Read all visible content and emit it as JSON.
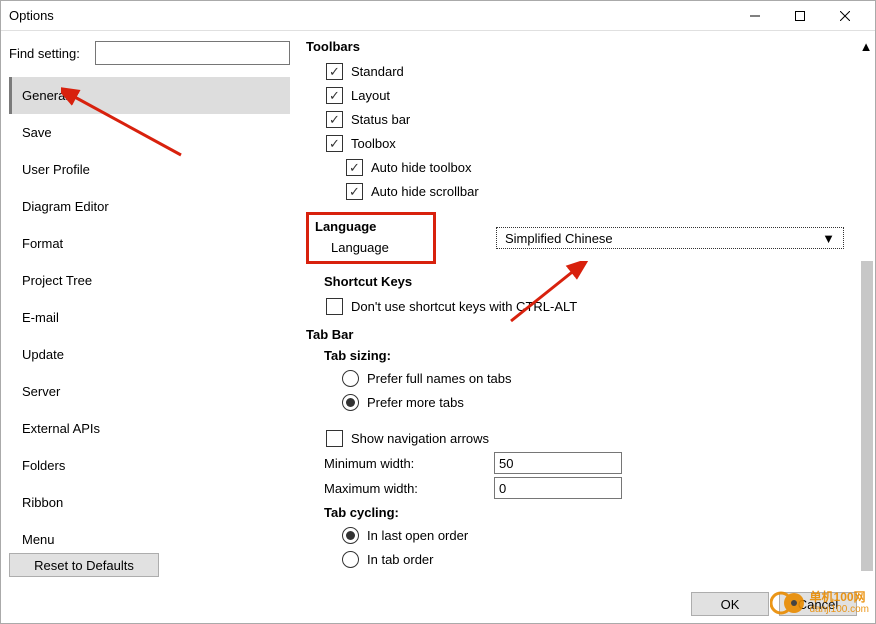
{
  "window": {
    "title": "Options"
  },
  "find": {
    "label": "Find setting:",
    "value": ""
  },
  "sidebar": {
    "items": [
      {
        "label": "General",
        "selected": true
      },
      {
        "label": "Save"
      },
      {
        "label": "User Profile"
      },
      {
        "label": "Diagram Editor"
      },
      {
        "label": "Format"
      },
      {
        "label": "Project Tree"
      },
      {
        "label": "E-mail"
      },
      {
        "label": "Update"
      },
      {
        "label": "Server"
      },
      {
        "label": "External APIs"
      },
      {
        "label": "Folders"
      },
      {
        "label": "Ribbon"
      },
      {
        "label": "Menu"
      }
    ],
    "toolbars_label": "Toolbars",
    "reset_label": "Reset to Defaults"
  },
  "toolbars": {
    "title": "Toolbars",
    "items": [
      {
        "label": "Standard",
        "checked": true
      },
      {
        "label": "Layout",
        "checked": true
      },
      {
        "label": "Status bar",
        "checked": true
      },
      {
        "label": "Toolbox",
        "checked": true
      }
    ],
    "sub": [
      {
        "label": "Auto hide toolbox",
        "checked": true
      },
      {
        "label": "Auto hide scrollbar",
        "checked": true
      }
    ]
  },
  "language": {
    "title": "Language",
    "label": "Language",
    "value": "Simplified Chinese"
  },
  "shortcut": {
    "title": "Shortcut Keys",
    "no_ctrl_alt": {
      "label": "Don't use shortcut keys with CTRL-ALT",
      "checked": false
    }
  },
  "tabbar": {
    "title": "Tab Bar",
    "sizing_title": "Tab sizing:",
    "sizing_opts": [
      {
        "label": "Prefer full names on tabs",
        "selected": false
      },
      {
        "label": "Prefer more tabs",
        "selected": true
      }
    ],
    "show_nav": {
      "label": "Show navigation arrows",
      "checked": false
    },
    "min_label": "Minimum width:",
    "min_value": "50",
    "max_label": "Maximum width:",
    "max_value": "0",
    "cycling_title": "Tab cycling:",
    "cycling_opts": [
      {
        "label": "In last open order",
        "selected": true
      },
      {
        "label": "In tab order",
        "selected": false
      }
    ]
  },
  "footer": {
    "ok": "OK",
    "cancel": "Cancel"
  },
  "watermark": {
    "line1": "单机100网",
    "line2": "danji100.com"
  }
}
